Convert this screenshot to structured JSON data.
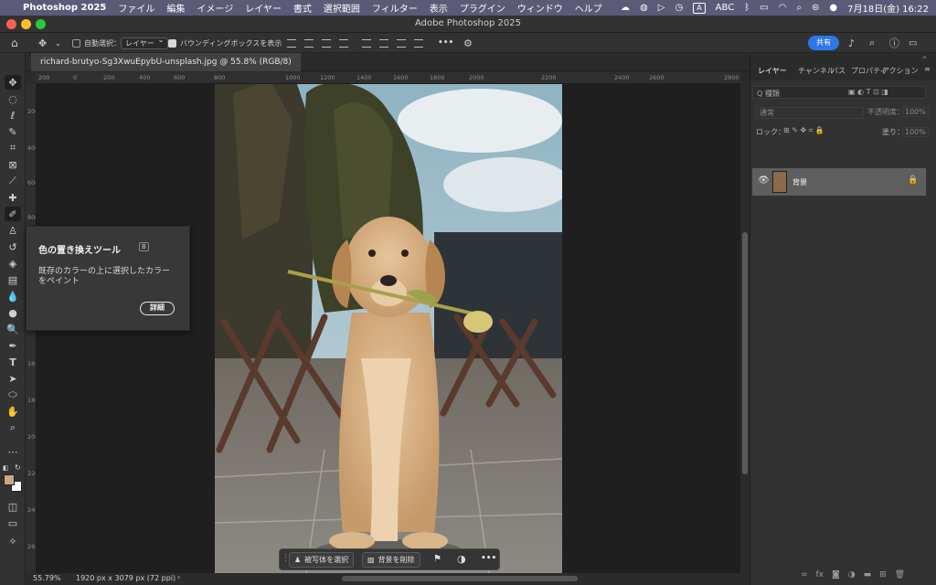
{
  "menubar": {
    "app_name": "Photoshop 2025",
    "items": [
      "ファイル",
      "編集",
      "イメージ",
      "レイヤー",
      "書式",
      "選択範囲",
      "フィルター",
      "表示",
      "プラグイン",
      "ウィンドウ",
      "ヘルプ"
    ],
    "input_badge": "A",
    "input_mode": "ABC",
    "datetime": "7月18日(金)  16:22"
  },
  "window": {
    "title": "Adobe Photoshop 2025"
  },
  "options_bar": {
    "auto_select_label": "自動選択：",
    "auto_select_target": "レイヤー",
    "bounding_box_label": "バウンディングボックスを表示",
    "more_label": "•••",
    "share_label": "共有"
  },
  "document": {
    "tab_label": "richard-brutyo-Sg3XwuEpybU-unsplash.jpg @ 55.8% (RGB/8)"
  },
  "rulers": {
    "horizontal": [
      "200",
      "0",
      "200",
      "400",
      "600",
      "800",
      "1000",
      "1200",
      "1400",
      "1600",
      "1800",
      "2000",
      "2200",
      "2400",
      "2600",
      "2800"
    ],
    "vertical": [
      "200",
      "400",
      "600",
      "800",
      "1000",
      "1200",
      "1400",
      "1600",
      "1800",
      "2000",
      "2200",
      "2400",
      "2600"
    ]
  },
  "tooltip": {
    "title": "色の置き換えツール",
    "shortcut": "B",
    "description": "既存のカラーの上に選択したカラーをペイント",
    "button": "詳細"
  },
  "taskbar": {
    "select_subject": "被写体を選択",
    "remove_background": "背景を削除",
    "more_label": "•••"
  },
  "status": {
    "zoom": "55.79%",
    "doc_info": "1920 px x 3079 px (72 ppi)",
    "arrow": "›"
  },
  "panels": {
    "tabs": [
      "レイヤー",
      "チャンネル",
      "パス",
      "プロパティ",
      "アクション"
    ],
    "kind_filter": "Q 種類",
    "blend_mode": "通常",
    "opacity_label": "不透明度：",
    "opacity_value": "100%",
    "lock_label": "ロック：",
    "fill_label": "塗り：",
    "fill_value": "100%",
    "layer_name": "背景",
    "fx_label": "fx"
  },
  "colors": {
    "menubar": "#5b5a78",
    "share_button": "#2d77e6",
    "foreground": "#c8a88a",
    "background": "#ffffff"
  }
}
